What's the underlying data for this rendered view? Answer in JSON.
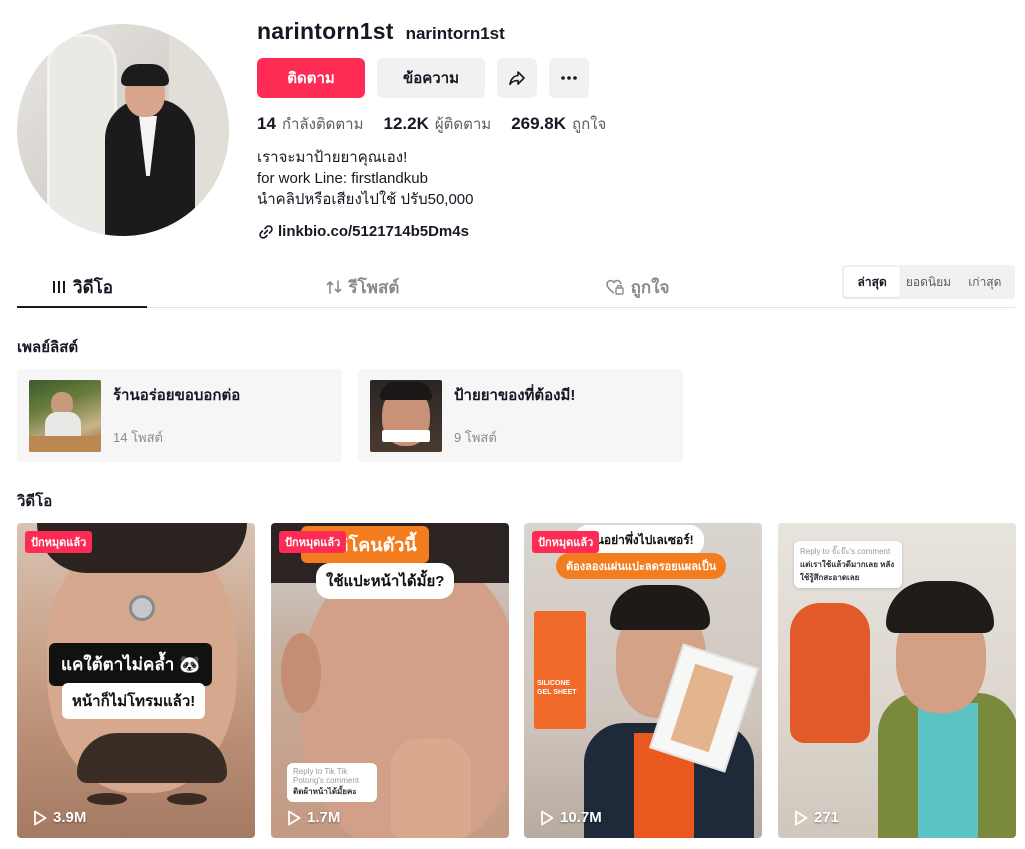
{
  "profile": {
    "username": "narintorn1st",
    "nickname": "narintorn1st",
    "follow_label": "ติดตาม",
    "message_label": "ข้อความ",
    "stats": [
      {
        "num": "14",
        "label": "กำลังติดตาม"
      },
      {
        "num": "12.2K",
        "label": "ผู้ติดตาม"
      },
      {
        "num": "269.8K",
        "label": "ถูกใจ"
      }
    ],
    "bio": [
      "เราจะมาป้ายยาคุณเอง!",
      "for work Line: firstlandkub",
      "นำคลิปหรือเสียงไปใช้ ปรับ50,000"
    ],
    "link": "linkbio.co/5121714b5Dm4s"
  },
  "tabs": [
    {
      "label": "วิดีโอ",
      "active": true
    },
    {
      "label": "รีโพสต์",
      "active": false
    },
    {
      "label": "ถูกใจ",
      "active": false
    }
  ],
  "sort": [
    "ล่าสุด",
    "ยอดนิยม",
    "เก่าสุด"
  ],
  "playlists": {
    "title": "เพลย์ลิสต์",
    "items": [
      {
        "title": "ร้านอร่อยขอบอกต่อ",
        "count": "14 โพสต์"
      },
      {
        "title": "ป้ายยาของที่ต้องมี!",
        "count": "9 โพสต์"
      }
    ]
  },
  "videos": {
    "title": "วิดีโอ",
    "items": [
      {
        "badge": "ปักหมุดแล้ว",
        "views": "3.9M",
        "caption1": "แคใต้ตาไม่คล้ำ 🐼",
        "caption2": "หน้าก็ไม่โทรมแล้ว!"
      },
      {
        "badge": "ปักหมุดแล้ว",
        "views": "1.7M",
        "caption1": "นซิลิโคนตัวนี้",
        "caption2": "ใช้แปะหน้าได้มั้ย?",
        "reply_title": "Reply to Tik Tik Potong's comment",
        "reply_text": "ติดผ้าหน้าได้มั้ยคะ"
      },
      {
        "badge": "ปักหมุดแล้ว",
        "views": "10.7M",
        "caption1": "เป็นอย่าพึ่งไปเลเซอร์!",
        "caption2": "ต้องลองแผ่นแปะลดรอยแผลเป็น",
        "product": "SILICONE GEL SHEET"
      },
      {
        "views": "271",
        "reply_title": "Reply to จั๊ะจ๊ะ's comment",
        "reply_text": "แต่เราใช้แล้วดีมากเลย หลังใช้รู้สึกสะอาดเลย"
      }
    ]
  },
  "colors": {
    "accent": "#fe2c55",
    "text": "#161823",
    "muted": "#8a8b91"
  }
}
